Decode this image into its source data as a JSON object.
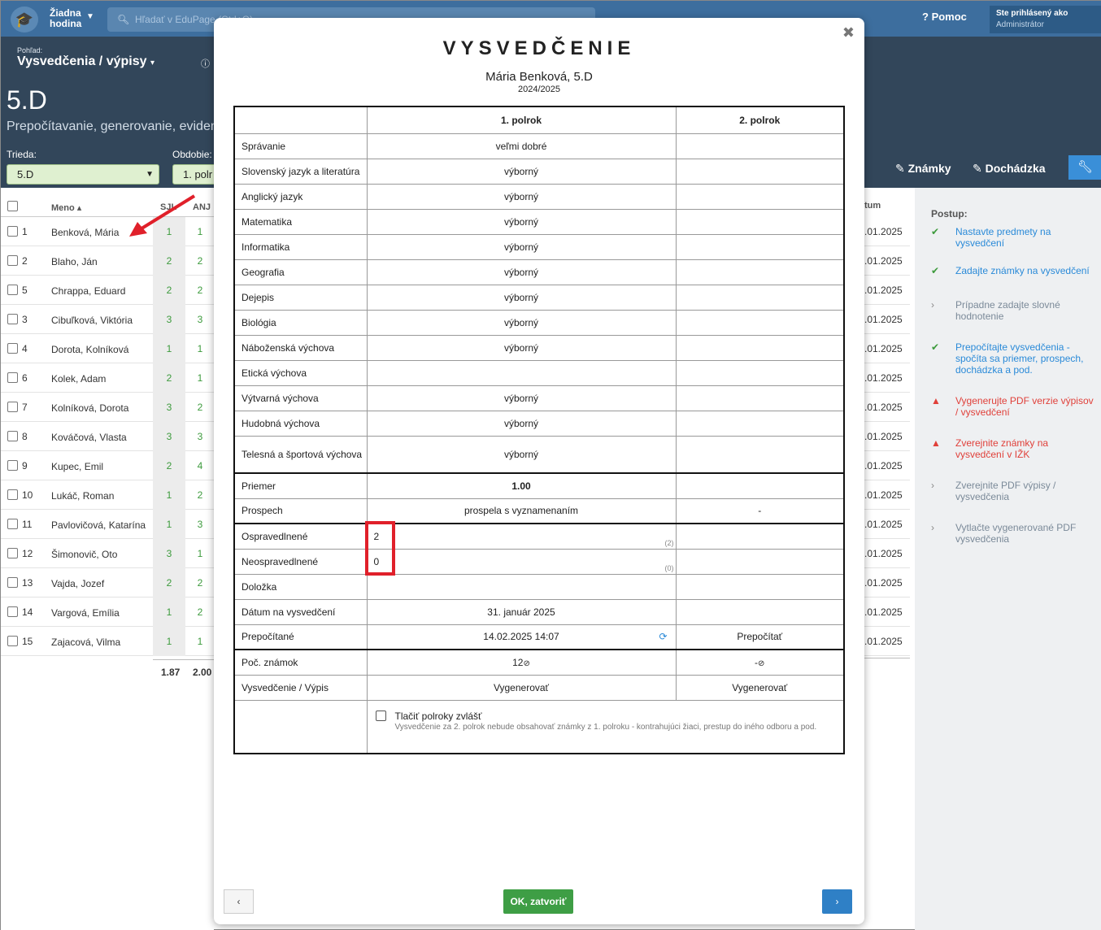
{
  "topbar": {
    "hodina_line1": "Žiadna",
    "hodina_line2": "hodina",
    "search_placeholder": "Hľadať v EduPage (Ctrl+Q)",
    "help": "Pomoc",
    "logged_line1": "Ste prihlásený ako",
    "logged_line2": "Administrátor"
  },
  "header": {
    "pohlad_label": "Pohľad:",
    "view_title": "Vysvedčenia / výpisy",
    "class_name": "5.D",
    "subtitle": "Prepočítavanie, generovanie, eviden",
    "trieda_label": "Trieda:",
    "trieda_value": "5.D",
    "obdobie_label": "Obdobie:",
    "obdobie_value": "1. polr",
    "znamky_btn": "Známky",
    "dochadzka_btn": "Dochádzka"
  },
  "grid": {
    "col_meno": "Meno",
    "col_sjl": "SJL",
    "col_anj": "ANJ",
    "col_datum": "tum",
    "rows": [
      {
        "num": "1",
        "name": "Benková, Mária",
        "g1": "1",
        "g2": "1",
        "date": ".01.2025"
      },
      {
        "num": "2",
        "name": "Blaho, Ján",
        "g1": "2",
        "g2": "2",
        "date": ".01.2025"
      },
      {
        "num": "5",
        "name": "Chrappa, Eduard",
        "g1": "2",
        "g2": "2",
        "date": ".01.2025"
      },
      {
        "num": "3",
        "name": "Cibuľková, Viktória",
        "g1": "3",
        "g2": "3",
        "date": ".01.2025"
      },
      {
        "num": "4",
        "name": "Dorota, Kolníková",
        "g1": "1",
        "g2": "1",
        "date": ".01.2025"
      },
      {
        "num": "6",
        "name": "Kolek, Adam",
        "g1": "2",
        "g2": "1",
        "date": ".01.2025"
      },
      {
        "num": "7",
        "name": "Kolníková, Dorota",
        "g1": "3",
        "g2": "2",
        "date": ".01.2025"
      },
      {
        "num": "8",
        "name": "Kováčová, Vlasta",
        "g1": "3",
        "g2": "3",
        "date": ".01.2025"
      },
      {
        "num": "9",
        "name": "Kupec, Emil",
        "g1": "2",
        "g2": "4",
        "date": ".01.2025"
      },
      {
        "num": "10",
        "name": "Lukáč, Roman",
        "g1": "1",
        "g2": "2",
        "date": ".01.2025"
      },
      {
        "num": "11",
        "name": "Pavlovičová, Katarína",
        "g1": "1",
        "g2": "3",
        "date": ".01.2025"
      },
      {
        "num": "12",
        "name": "Šimonovič, Oto",
        "g1": "3",
        "g2": "1",
        "date": ".01.2025"
      },
      {
        "num": "13",
        "name": "Vajda, Jozef",
        "g1": "2",
        "g2": "2",
        "date": ".01.2025"
      },
      {
        "num": "14",
        "name": "Vargová, Emília",
        "g1": "1",
        "g2": "2",
        "date": ".01.2025"
      },
      {
        "num": "15",
        "name": "Zajacová, Vilma",
        "g1": "1",
        "g2": "1",
        "date": ".01.2025"
      }
    ],
    "avg_sjl": "1.87",
    "avg_anj": "2.00"
  },
  "side": {
    "title": "Postup:",
    "steps": [
      {
        "status": "done",
        "text": "Nastavte predmety na vysvedčení"
      },
      {
        "status": "done",
        "text": "Zadajte známky na vysvedčení"
      },
      {
        "status": "todo",
        "text": "Prípadne zadajte slovné hodnotenie"
      },
      {
        "status": "done",
        "text": "Prepočítajte vysvedčenia - spočíta sa priemer, prospech, dochádzka a pod."
      },
      {
        "status": "warn",
        "text": "Vygenerujte PDF verzie výpisov / vysvedčení"
      },
      {
        "status": "warn",
        "text": "Zverejnite známky na vysvedčení v IŽK"
      },
      {
        "status": "todo",
        "text": "Zverejnite PDF výpisy / vysvedčenia"
      },
      {
        "status": "todo",
        "text": "Vytlačte vygenerované PDF vysvedčenia"
      }
    ]
  },
  "modal": {
    "title": "VYSVEDČENIE",
    "student": "Mária Benková, 5.D",
    "year": "2024/2025",
    "col1": "1. polrok",
    "col2": "2. polrok",
    "subjects": [
      {
        "name": "Správanie",
        "grade": "veľmi dobré"
      },
      {
        "name": "Slovenský jazyk a literatúra",
        "grade": "výborný"
      },
      {
        "name": "Anglický jazyk",
        "grade": "výborný"
      },
      {
        "name": "Matematika",
        "grade": "výborný"
      },
      {
        "name": "Informatika",
        "grade": "výborný"
      },
      {
        "name": "Geografia",
        "grade": "výborný"
      },
      {
        "name": "Dejepis",
        "grade": "výborný"
      },
      {
        "name": "Biológia",
        "grade": "výborný"
      },
      {
        "name": "Náboženská výchova",
        "grade": "výborný"
      },
      {
        "name": "Etická výchova",
        "grade": ""
      },
      {
        "name": "Výtvarná výchova",
        "grade": "výborný"
      },
      {
        "name": "Hudobná výchova",
        "grade": "výborný"
      },
      {
        "name": "Telesná a športová výchova",
        "grade": "výborný"
      }
    ],
    "priemer_label": "Priemer",
    "priemer_value": "1.00",
    "prospech_label": "Prospech",
    "prospech_value": "prospela s vyznamenaním",
    "prospech_value2": "-",
    "ospr_label": "Ospravedlnené",
    "ospr_value": "2",
    "ospr_paren": "(2)",
    "neospr_label": "Neospravedlnené",
    "neospr_value": "0",
    "neospr_paren": "(0)",
    "dolozka_label": "Doložka",
    "datum_label": "Dátum na vysvedčení",
    "datum_value": "31. január 2025",
    "prepoc_label": "Prepočítané",
    "prepoc_value": "14.02.2025 14:07",
    "prepoc_link": "Prepočítať",
    "pocz_label": "Poč. známok",
    "pocz_value": "12",
    "pocz_value2": "-",
    "vysv_label": "Vysvedčenie / Výpis",
    "vygen1": "Vygenerovať",
    "vygen2": "Vygenerovať",
    "chk_label": "Tlačiť polroky zvlášť",
    "chk_sub": "Vysvedčenie za 2. polrok nebude obsahovať známky z 1. polroku - kontrahujúci žiaci, prestup do iného odboru a pod.",
    "prev_btn": "‹",
    "ok_btn": "OK, zatvoriť",
    "next_btn": "›"
  }
}
